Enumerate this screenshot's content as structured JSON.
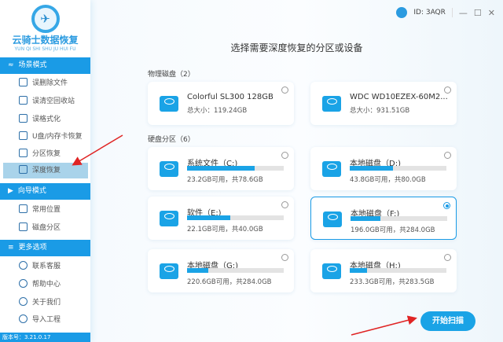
{
  "app": {
    "name": "云骑士数据恢复",
    "pinyin": "YUN QI SHI SHU JU HUI FU",
    "id": "ID: 3AQR",
    "version": "版本号：3.21.0.17"
  },
  "sidebar": {
    "scene": {
      "label": "场景模式",
      "items": [
        "误删除文件",
        "误清空回收站",
        "误格式化",
        "U盘/内存卡恢复",
        "分区恢复",
        "深度恢复"
      ]
    },
    "guide": {
      "label": "向导模式",
      "items": [
        "常用位置",
        "磁盘分区"
      ]
    },
    "more": {
      "label": "更多选项",
      "items": [
        "联系客服",
        "帮助中心",
        "关于我们",
        "导入工程"
      ]
    }
  },
  "main": {
    "title": "选择需要深度恢复的分区或设备",
    "physical_label": "物理磁盘（2）",
    "physical": [
      {
        "name": "Colorful SL300 128GB",
        "size": "总大小：119.24GB"
      },
      {
        "name": "WDC WD10EZEX-60M2...",
        "size": "总大小：931.51GB"
      }
    ],
    "partition_label": "硬盘分区（6）",
    "partitions": [
      {
        "name": "系统文件（C:)",
        "info": "23.2GB可用，共78.6GB",
        "used": 0.7
      },
      {
        "name": "本地磁盘（D:)",
        "info": "43.8GB可用，共80.0GB",
        "used": 0.45
      },
      {
        "name": "软件（E:)",
        "info": "22.1GB可用，共40.0GB",
        "used": 0.45
      },
      {
        "name": "本地磁盘（F:)",
        "info": "196.0GB可用，共284.0GB",
        "used": 0.31,
        "selected": true
      },
      {
        "name": "本地磁盘（G:)",
        "info": "220.6GB可用，共284.0GB",
        "used": 0.22
      },
      {
        "name": "本地磁盘（H:)",
        "info": "233.3GB可用，共283.5GB",
        "used": 0.18
      }
    ],
    "scan_button": "开始扫描"
  },
  "colors": {
    "accent": "#1a9be6",
    "arrow": "#e02424"
  }
}
